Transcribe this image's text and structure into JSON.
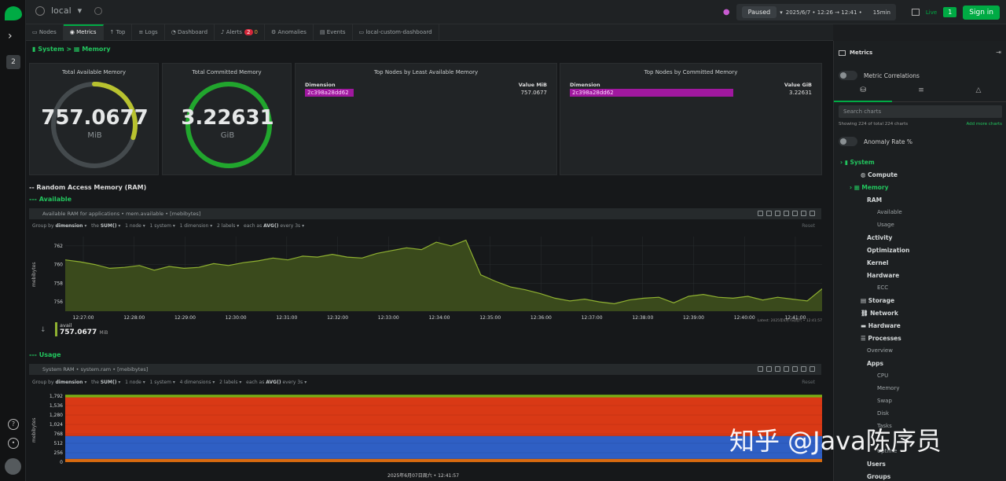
{
  "topbar": {
    "room": "local",
    "paused": "Paused",
    "time_range": "2025/6/7 • 12:26 → 12:41 •",
    "duration": "15min",
    "live": "Live",
    "live_count": "1",
    "sign_in": "Sign in"
  },
  "leftbar": {
    "space_badge": "2"
  },
  "tabs": [
    {
      "label": "Nodes"
    },
    {
      "label": "Metrics"
    },
    {
      "label": "Top"
    },
    {
      "label": "Logs"
    },
    {
      "label": "Dashboard"
    },
    {
      "label": "Alerts",
      "critical": "2",
      "warning": "0"
    },
    {
      "label": "Anomalies"
    },
    {
      "label": "Events"
    },
    {
      "label": "local-custom-dashboard"
    }
  ],
  "breadcrumb": {
    "root": "System",
    "sep": ">",
    "current": "Memory"
  },
  "gauges": [
    {
      "title": "Total Available Memory",
      "value": "757.0677",
      "unit": "MiB",
      "fill": 0.3
    },
    {
      "title": "Total Committed Memory",
      "value": "3.22631",
      "unit": "GiB",
      "fill": 1.0
    }
  ],
  "top_least": {
    "title": "Top Nodes by Least Available Memory",
    "dim_header": "Dimension",
    "val_header": "Value MiB",
    "row_dim": "2c398a28dd62",
    "row_val": "757.0677"
  },
  "top_committed": {
    "title": "Top Nodes by Committed Memory",
    "dim_header": "Dimension",
    "val_header": "Value GiB",
    "row_dim": "2c398a28dd62",
    "row_val": "3.22631"
  },
  "sections": {
    "ram": "-- Random Access Memory (RAM)",
    "available": "--- Available",
    "usage": "--- Usage"
  },
  "chart1": {
    "title": "Available RAM for applications • mem.available • [mebibytes]",
    "opts": {
      "group_by": "Group by",
      "group_dim": "dimension",
      "the": "the",
      "agg": "SUM()",
      "nodes": "1 node",
      "systems": "1 system",
      "dims": "1 dimension",
      "labels": "2 labels",
      "each_as": "each as",
      "each_agg": "AVG()",
      "every": "every 3s",
      "reset": "Reset"
    },
    "latest": "Latest: 2025年6月7日周六 • 12:41:57",
    "legend_name": "avail",
    "legend_value": "757.0677",
    "legend_unit": "MiB"
  },
  "chart2": {
    "title": "System RAM • system.ram • [mebibytes]",
    "opts": {
      "group_by": "Group by",
      "group_dim": "dimension",
      "the": "the",
      "agg": "SUM()",
      "nodes": "1 node",
      "systems": "1 system",
      "dims": "4 dimensions",
      "labels": "2 labels",
      "each_as": "each as",
      "each_agg": "AVG()",
      "every": "every 3s",
      "reset": "Reset"
    }
  },
  "footer_time": "2025年6月07日周六 • 12:41:57",
  "right_panel": {
    "title": "Metrics",
    "correlations": "Metric Correlations",
    "search_placeholder": "Search charts",
    "showing": "Showing 224 of total 224 charts",
    "add_more": "Add more charts",
    "anomaly": "Anomaly Rate %",
    "tree": [
      "System",
      "Compute",
      "Memory",
      "RAM",
      "Available",
      "Usage",
      "Activity",
      "Optimization",
      "Kernel",
      "Hardware",
      "ECC",
      "Storage",
      "Network",
      "Hardware",
      "Processes",
      "Overview",
      "Apps",
      "CPU",
      "Memory",
      "Swap",
      "Disk",
      "Tasks",
      "Uptime",
      "Users",
      "Groups"
    ]
  },
  "watermark": "知乎 @Java陈序员",
  "colors": {
    "accent": "#00ab44",
    "avail_line": "#8fb131",
    "avail_fill": "#3a4a1c",
    "free": "#7fb516",
    "used": "#2f5fc4",
    "cached": "#d93915",
    "buffers": "#d86a10",
    "magenta": "#a0189f"
  },
  "chart_data": [
    {
      "type": "area",
      "title": "Available RAM for applications • mem.available • [mebibytes]",
      "ylabel": "mebibytes",
      "ylim": [
        755,
        763
      ],
      "yticks": [
        756,
        758,
        760,
        762
      ],
      "xticks": [
        "12:27:00",
        "12:28:00",
        "12:29:00",
        "12:30:00",
        "12:31:00",
        "12:32:00",
        "12:33:00",
        "12:34:00",
        "12:35:00",
        "12:36:00",
        "12:37:00",
        "12:38:00",
        "12:39:00",
        "12:40:00",
        "12:41:00"
      ],
      "series": [
        {
          "name": "avail",
          "values": [
            760.5,
            760.3,
            760.0,
            759.6,
            759.7,
            759.9,
            759.4,
            759.8,
            759.6,
            759.7,
            760.1,
            759.9,
            760.2,
            760.4,
            760.7,
            760.5,
            760.9,
            760.8,
            761.1,
            760.8,
            760.7,
            761.2,
            761.5,
            761.8,
            761.6,
            762.4,
            762.0,
            762.6,
            758.9,
            758.2,
            757.6,
            757.3,
            756.9,
            756.4,
            756.1,
            756.3,
            756.0,
            755.8,
            756.2,
            756.4,
            756.5,
            755.9,
            756.6,
            756.8,
            756.5,
            756.4,
            756.6,
            756.2,
            756.5,
            756.3,
            756.1,
            757.4
          ]
        }
      ]
    },
    {
      "type": "area",
      "title": "System RAM • system.ram • [mebibytes]",
      "ylabel": "mebibytes",
      "ylim": [
        0,
        1900
      ],
      "yticks": [
        0,
        256,
        512,
        768,
        1024,
        1280,
        1536,
        1792
      ],
      "series": [
        {
          "values": [
            90
          ]
        },
        {
          "values": [
            620
          ]
        },
        {
          "values": [
            1050
          ]
        },
        {
          "values": [
            70
          ]
        }
      ]
    }
  ]
}
